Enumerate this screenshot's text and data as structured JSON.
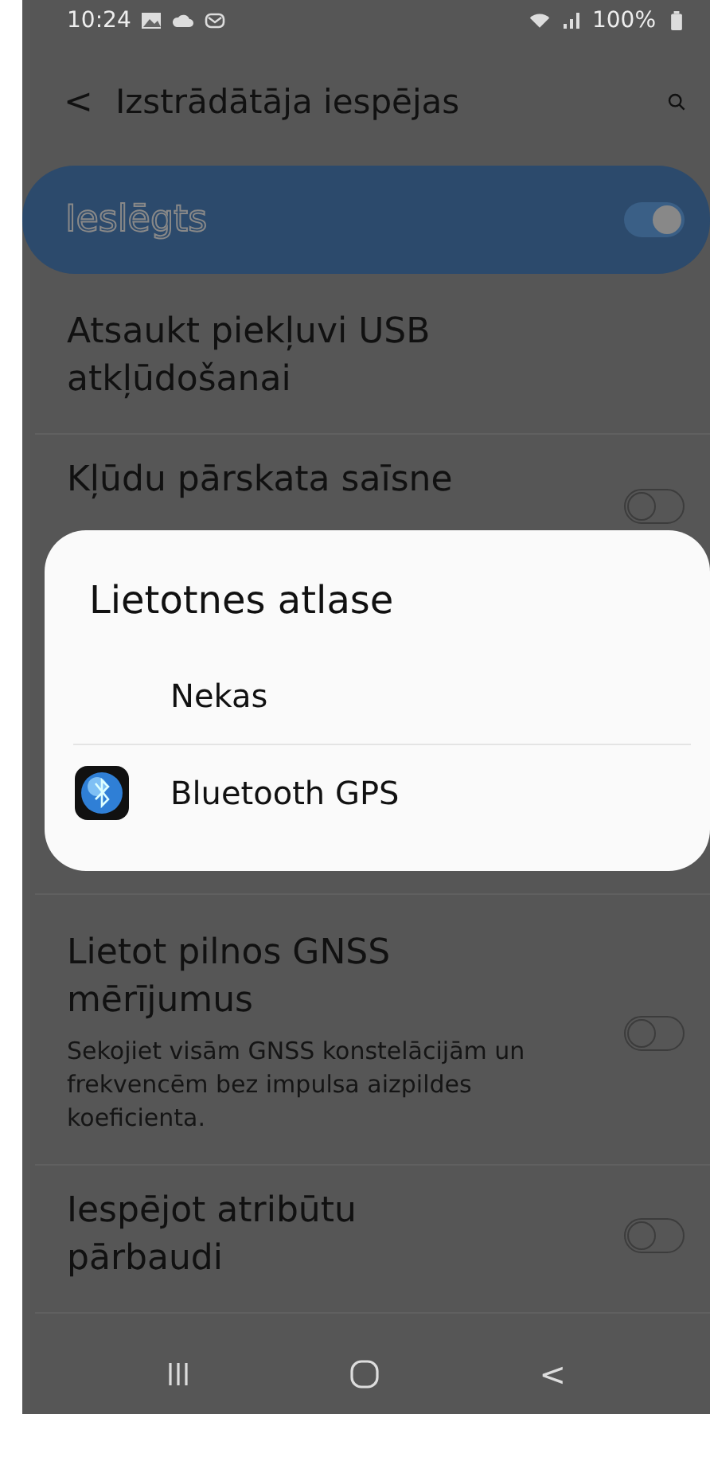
{
  "status_bar": {
    "time": "10:24",
    "battery": "100%"
  },
  "header": {
    "back": "<",
    "title": "Izstrādātāja iespējas"
  },
  "master_switch": {
    "label": "Ieslēgts",
    "on": true
  },
  "settings": [
    {
      "kind": "action",
      "title": "Atsaukt piekļuvi USB atkļūdošanai"
    },
    {
      "kind": "switch",
      "title": "Kļūdu pārskata saīsne",
      "on": false
    },
    {
      "kind": "switch",
      "title": "Lietot pilnos GNSS mērījumus",
      "description": "Sekojiet visām GNSS konstelācijām un frekvencēm bez impulsa aizpildes koeficienta.",
      "on": false
    },
    {
      "kind": "switch",
      "title": "Iespējot atribūtu pārbaudi",
      "on": false
    }
  ],
  "dialog": {
    "title": "Lietotnes atlase",
    "options": [
      {
        "label": "Nekas",
        "kind": "none"
      },
      {
        "label": "Bluetooth GPS",
        "kind": "app"
      }
    ]
  },
  "nav_bar": {
    "back": "<"
  }
}
